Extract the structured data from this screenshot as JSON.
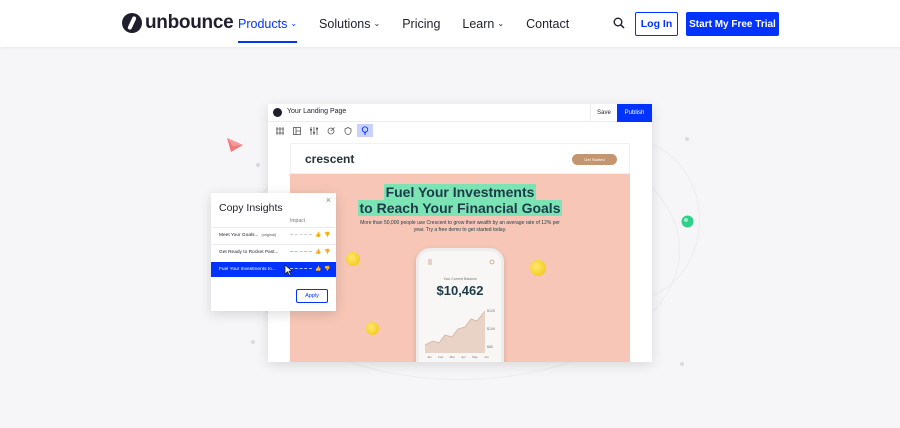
{
  "nav": {
    "brand": "unbounce",
    "items": [
      {
        "label": "Products",
        "caret": "⌄",
        "active": true
      },
      {
        "label": "Solutions",
        "caret": "⌄",
        "active": false
      },
      {
        "label": "Pricing",
        "caret": "",
        "active": false
      },
      {
        "label": "Learn",
        "caret": "⌄",
        "active": false
      },
      {
        "label": "Contact",
        "caret": "",
        "active": false
      }
    ],
    "login_label": "Log In",
    "trial_label": "Start My Free Trial",
    "search_icon": "search-icon"
  },
  "colors": {
    "accent": "#0033ff",
    "hero_bg": "#f7c6b6",
    "highlight": "#7ce3b4",
    "cta_tan": "#c39671"
  },
  "editor": {
    "title": "Your Landing Page",
    "save_label": "Save",
    "publish_label": "Publish",
    "landing": {
      "brand": "crescent",
      "cta_label": "Get Started",
      "headline_line1": "Fuel Your Investments",
      "headline_line2": "to Reach Your Financial Goals",
      "subtext": "More than 50,000 people use Crescent to grow their wealth by an average rate of 12% per year. Try a free demo to get started today.",
      "phone": {
        "label": "Your Current Balance",
        "balance": "$10,462",
        "axis": [
          "$12K",
          "$10K",
          "$8K"
        ],
        "months": [
          "Jan",
          "Feb",
          "Mar",
          "Apr",
          "May",
          "Jun"
        ]
      }
    }
  },
  "insights": {
    "title": "Copy Insights",
    "close": "×",
    "impact_label": "Impact",
    "rows": [
      {
        "label": "Meet Your Goals...",
        "tag": "(original)"
      },
      {
        "label": "Get Ready to Rocket Past...",
        "tag": ""
      },
      {
        "label": "Fuel Your Investments to...",
        "tag": ""
      }
    ],
    "apply_label": "Apply"
  }
}
